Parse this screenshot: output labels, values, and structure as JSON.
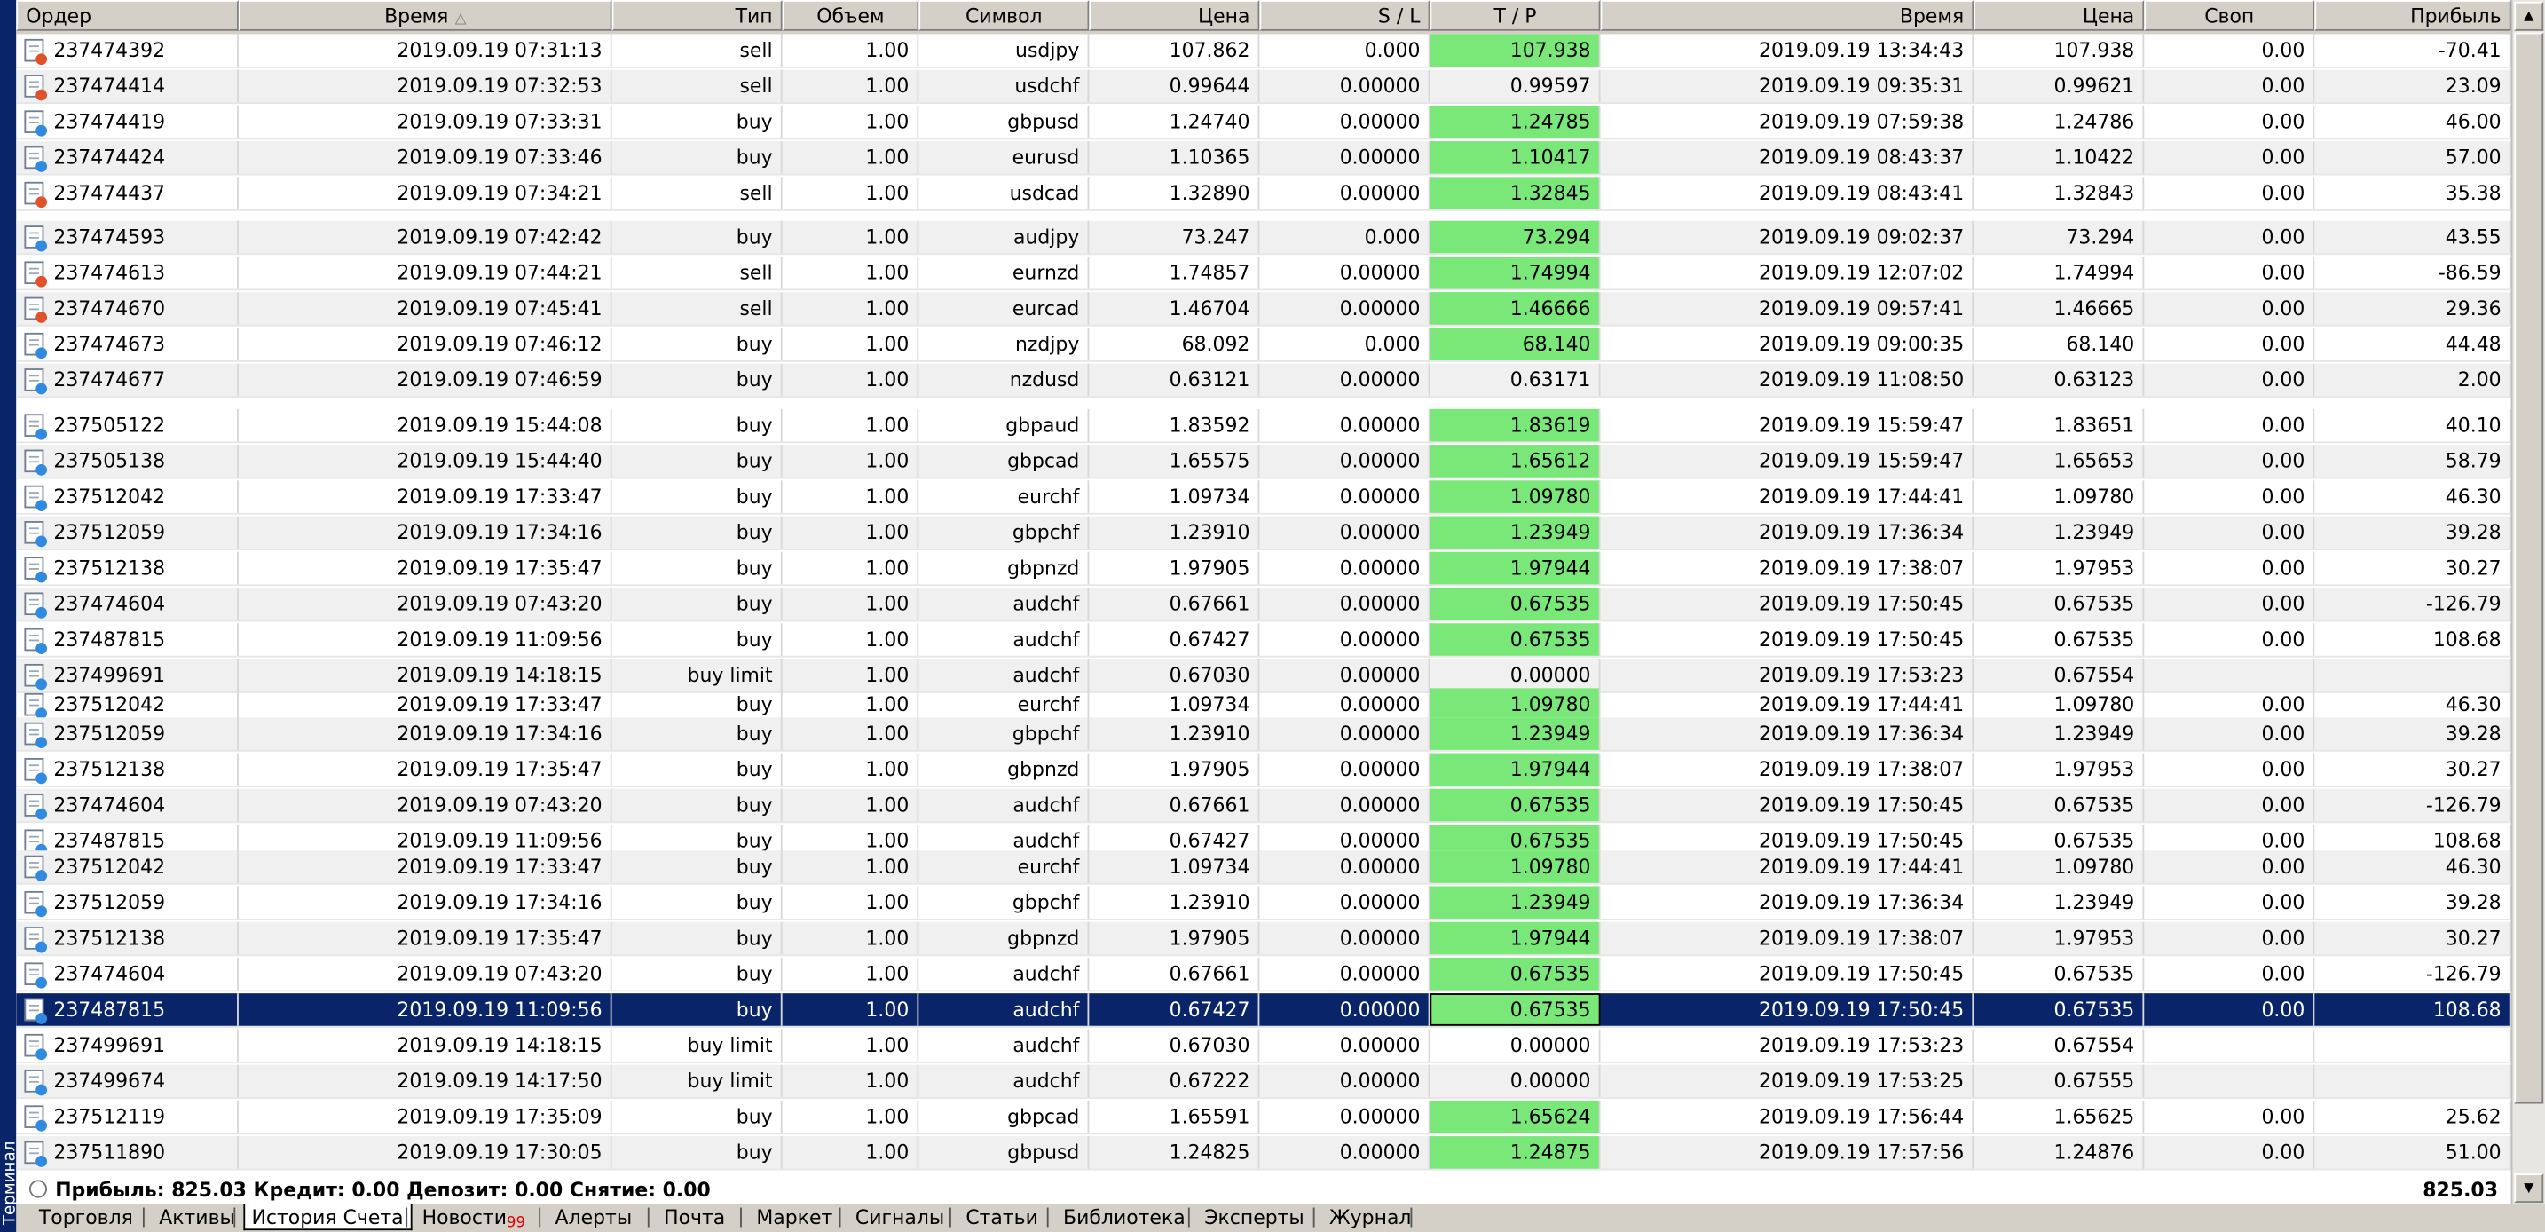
{
  "side_label": "Терминал",
  "columns": [
    {
      "key": "order",
      "label": "Ордер",
      "align": "left"
    },
    {
      "key": "open_time",
      "label": "Время",
      "align": "center",
      "sorted": true
    },
    {
      "key": "type",
      "label": "Тип",
      "align": "right"
    },
    {
      "key": "volume",
      "label": "Объем",
      "align": "center"
    },
    {
      "key": "symbol",
      "label": "Символ",
      "align": "center"
    },
    {
      "key": "price",
      "label": "Цена",
      "align": "right"
    },
    {
      "key": "sl",
      "label": "S / L",
      "align": "right"
    },
    {
      "key": "tp",
      "label": "T / P",
      "align": "center"
    },
    {
      "key": "close_time",
      "label": "Время",
      "align": "right"
    },
    {
      "key": "close_price",
      "label": "Цена",
      "align": "right"
    },
    {
      "key": "swap",
      "label": "Своп",
      "align": "center"
    },
    {
      "key": "profit",
      "label": "Прибыль",
      "align": "right"
    }
  ],
  "rows": [
    {
      "order": "237474392",
      "open_time": "2019.09.19 07:31:13",
      "type": "sell",
      "volume": "1.00",
      "symbol": "usdjpy",
      "price": "107.862",
      "sl": "0.000",
      "tp": "107.938",
      "tp_hit": true,
      "close_time": "2019.09.19 13:34:43",
      "close_price": "107.938",
      "swap": "0.00",
      "profit": "-70.41",
      "side": "sell"
    },
    {
      "order": "237474414",
      "open_time": "2019.09.19 07:32:53",
      "type": "sell",
      "volume": "1.00",
      "symbol": "usdchf",
      "price": "0.99644",
      "sl": "0.00000",
      "tp": "0.99597",
      "tp_hit": false,
      "close_time": "2019.09.19 09:35:31",
      "close_price": "0.99621",
      "swap": "0.00",
      "profit": "23.09",
      "side": "sell"
    },
    {
      "order": "237474419",
      "open_time": "2019.09.19 07:33:31",
      "type": "buy",
      "volume": "1.00",
      "symbol": "gbpusd",
      "price": "1.24740",
      "sl": "0.00000",
      "tp": "1.24785",
      "tp_hit": true,
      "close_time": "2019.09.19 07:59:38",
      "close_price": "1.24786",
      "swap": "0.00",
      "profit": "46.00",
      "side": "buy"
    },
    {
      "order": "237474424",
      "open_time": "2019.09.19 07:33:46",
      "type": "buy",
      "volume": "1.00",
      "symbol": "eurusd",
      "price": "1.10365",
      "sl": "0.00000",
      "tp": "1.10417",
      "tp_hit": true,
      "close_time": "2019.09.19 08:43:37",
      "close_price": "1.10422",
      "swap": "0.00",
      "profit": "57.00",
      "side": "buy"
    },
    {
      "order": "237474437",
      "open_time": "2019.09.19 07:34:21",
      "type": "sell",
      "volume": "1.00",
      "symbol": "usdcad",
      "price": "1.32890",
      "sl": "0.00000",
      "tp": "1.32845",
      "tp_hit": true,
      "close_time": "2019.09.19 08:43:41",
      "close_price": "1.32843",
      "swap": "0.00",
      "profit": "35.38",
      "side": "sell"
    },
    {
      "order": "237474593",
      "open_time": "2019.09.19 07:42:42",
      "type": "buy",
      "volume": "1.00",
      "symbol": "audjpy",
      "price": "73.247",
      "sl": "0.000",
      "tp": "73.294",
      "tp_hit": true,
      "close_time": "2019.09.19 09:02:37",
      "close_price": "73.294",
      "swap": "0.00",
      "profit": "43.55",
      "side": "buy"
    },
    {
      "order": "237474613",
      "open_time": "2019.09.19 07:44:21",
      "type": "sell",
      "volume": "1.00",
      "symbol": "eurnzd",
      "price": "1.74857",
      "sl": "0.00000",
      "tp": "1.74994",
      "tp_hit": true,
      "close_time": "2019.09.19 12:07:02",
      "close_price": "1.74994",
      "swap": "0.00",
      "profit": "-86.59",
      "side": "sell"
    },
    {
      "order": "237474670",
      "open_time": "2019.09.19 07:45:41",
      "type": "sell",
      "volume": "1.00",
      "symbol": "eurcad",
      "price": "1.46704",
      "sl": "0.00000",
      "tp": "1.46666",
      "tp_hit": true,
      "close_time": "2019.09.19 09:57:41",
      "close_price": "1.46665",
      "swap": "0.00",
      "profit": "29.36",
      "side": "sell"
    },
    {
      "order": "237474673",
      "open_time": "2019.09.19 07:46:12",
      "type": "buy",
      "volume": "1.00",
      "symbol": "nzdjpy",
      "price": "68.092",
      "sl": "0.000",
      "tp": "68.140",
      "tp_hit": true,
      "close_time": "2019.09.19 09:00:35",
      "close_price": "68.140",
      "swap": "0.00",
      "profit": "44.48",
      "side": "buy"
    },
    {
      "order": "237474677",
      "open_time": "2019.09.19 07:46:59",
      "type": "buy",
      "volume": "1.00",
      "symbol": "nzdusd",
      "price": "0.63121",
      "sl": "0.00000",
      "tp": "0.63171",
      "tp_hit": false,
      "close_time": "2019.09.19 11:08:50",
      "close_price": "0.63123",
      "swap": "0.00",
      "profit": "2.00",
      "side": "buy"
    },
    {
      "order": "237505122",
      "open_time": "2019.09.19 15:44:08",
      "type": "buy",
      "volume": "1.00",
      "symbol": "gbpaud",
      "price": "1.83592",
      "sl": "0.00000",
      "tp": "1.83619",
      "tp_hit": true,
      "close_time": "2019.09.19 15:59:47",
      "close_price": "1.83651",
      "swap": "0.00",
      "profit": "40.10",
      "side": "buy"
    },
    {
      "order": "237505138",
      "open_time": "2019.09.19 15:44:40",
      "type": "buy",
      "volume": "1.00",
      "symbol": "gbpcad",
      "price": "1.65575",
      "sl": "0.00000",
      "tp": "1.65612",
      "tp_hit": true,
      "close_time": "2019.09.19 15:59:47",
      "close_price": "1.65653",
      "swap": "0.00",
      "profit": "58.79",
      "side": "buy"
    },
    {
      "order": "237512042",
      "open_time": "2019.09.19 17:33:47",
      "type": "buy",
      "volume": "1.00",
      "symbol": "eurchf",
      "price": "1.09734",
      "sl": "0.00000",
      "tp": "1.09780",
      "tp_hit": true,
      "close_time": "2019.09.19 17:44:41",
      "close_price": "1.09780",
      "swap": "0.00",
      "profit": "46.30",
      "side": "buy"
    },
    {
      "order": "237512059",
      "open_time": "2019.09.19 17:34:16",
      "type": "buy",
      "volume": "1.00",
      "symbol": "gbpchf",
      "price": "1.23910",
      "sl": "0.00000",
      "tp": "1.23949",
      "tp_hit": true,
      "close_time": "2019.09.19 17:36:34",
      "close_price": "1.23949",
      "swap": "0.00",
      "profit": "39.28",
      "side": "buy"
    },
    {
      "order": "237512138",
      "open_time": "2019.09.19 17:35:47",
      "type": "buy",
      "volume": "1.00",
      "symbol": "gbpnzd",
      "price": "1.97905",
      "sl": "0.00000",
      "tp": "1.97944",
      "tp_hit": true,
      "close_time": "2019.09.19 17:38:07",
      "close_price": "1.97953",
      "swap": "0.00",
      "profit": "30.27",
      "side": "buy"
    },
    {
      "order": "237474604",
      "open_time": "2019.09.19 07:43:20",
      "type": "buy",
      "volume": "1.00",
      "symbol": "audchf",
      "price": "0.67661",
      "sl": "0.00000",
      "tp": "0.67535",
      "tp_hit": true,
      "close_time": "2019.09.19 17:50:45",
      "close_price": "0.67535",
      "swap": "0.00",
      "profit": "-126.79",
      "side": "buy"
    },
    {
      "order": "237487815",
      "open_time": "2019.09.19 11:09:56",
      "type": "buy",
      "volume": "1.00",
      "symbol": "audchf",
      "price": "0.67427",
      "sl": "0.00000",
      "tp": "0.67535",
      "tp_hit": true,
      "close_time": "2019.09.19 17:50:45",
      "close_price": "0.67535",
      "swap": "0.00",
      "profit": "108.68",
      "side": "buy"
    },
    {
      "order": "237499691",
      "open_time": "2019.09.19 14:18:15",
      "type": "buy limit",
      "volume": "1.00",
      "symbol": "audchf",
      "price": "0.67030",
      "sl": "0.00000",
      "tp": "0.00000",
      "tp_hit": false,
      "close_time": "2019.09.19 17:53:23",
      "close_price": "0.67554",
      "swap": "",
      "profit": "",
      "side": "buy"
    },
    {
      "order": "237512042",
      "open_time": "2019.09.19 17:33:47",
      "type": "buy",
      "volume": "1.00",
      "symbol": "eurchf",
      "price": "1.09734",
      "sl": "0.00000",
      "tp": "1.09780",
      "tp_hit": true,
      "close_time": "2019.09.19 17:44:41",
      "close_price": "1.09780",
      "swap": "0.00",
      "profit": "46.30",
      "side": "buy"
    },
    {
      "order": "237512059",
      "open_time": "2019.09.19 17:34:16",
      "type": "buy",
      "volume": "1.00",
      "symbol": "gbpchf",
      "price": "1.23910",
      "sl": "0.00000",
      "tp": "1.23949",
      "tp_hit": true,
      "close_time": "2019.09.19 17:36:34",
      "close_price": "1.23949",
      "swap": "0.00",
      "profit": "39.28",
      "side": "buy"
    },
    {
      "order": "237512138",
      "open_time": "2019.09.19 17:35:47",
      "type": "buy",
      "volume": "1.00",
      "symbol": "gbpnzd",
      "price": "1.97905",
      "sl": "0.00000",
      "tp": "1.97944",
      "tp_hit": true,
      "close_time": "2019.09.19 17:38:07",
      "close_price": "1.97953",
      "swap": "0.00",
      "profit": "30.27",
      "side": "buy"
    },
    {
      "order": "237474604",
      "open_time": "2019.09.19 07:43:20",
      "type": "buy",
      "volume": "1.00",
      "symbol": "audchf",
      "price": "0.67661",
      "sl": "0.00000",
      "tp": "0.67535",
      "tp_hit": true,
      "close_time": "2019.09.19 17:50:45",
      "close_price": "0.67535",
      "swap": "0.00",
      "profit": "-126.79",
      "side": "buy"
    },
    {
      "order": "237487815",
      "open_time": "2019.09.19 11:09:56",
      "type": "buy",
      "volume": "1.00",
      "symbol": "audchf",
      "price": "0.67427",
      "sl": "0.00000",
      "tp": "0.67535",
      "tp_hit": true,
      "close_time": "2019.09.19 17:50:45",
      "close_price": "0.67535",
      "swap": "0.00",
      "profit": "108.68",
      "side": "buy"
    },
    {
      "order": "237512042",
      "open_time": "2019.09.19 17:33:47",
      "type": "buy",
      "volume": "1.00",
      "symbol": "eurchf",
      "price": "1.09734",
      "sl": "0.00000",
      "tp": "1.09780",
      "tp_hit": true,
      "close_time": "2019.09.19 17:44:41",
      "close_price": "1.09780",
      "swap": "0.00",
      "profit": "46.30",
      "side": "buy"
    },
    {
      "order": "237512059",
      "open_time": "2019.09.19 17:34:16",
      "type": "buy",
      "volume": "1.00",
      "symbol": "gbpchf",
      "price": "1.23910",
      "sl": "0.00000",
      "tp": "1.23949",
      "tp_hit": true,
      "close_time": "2019.09.19 17:36:34",
      "close_price": "1.23949",
      "swap": "0.00",
      "profit": "39.28",
      "side": "buy"
    },
    {
      "order": "237512138",
      "open_time": "2019.09.19 17:35:47",
      "type": "buy",
      "volume": "1.00",
      "symbol": "gbpnzd",
      "price": "1.97905",
      "sl": "0.00000",
      "tp": "1.97944",
      "tp_hit": true,
      "close_time": "2019.09.19 17:38:07",
      "close_price": "1.97953",
      "swap": "0.00",
      "profit": "30.27",
      "side": "buy"
    },
    {
      "order": "237474604",
      "open_time": "2019.09.19 07:43:20",
      "type": "buy",
      "volume": "1.00",
      "symbol": "audchf",
      "price": "0.67661",
      "sl": "0.00000",
      "tp": "0.67535",
      "tp_hit": true,
      "close_time": "2019.09.19 17:50:45",
      "close_price": "0.67535",
      "swap": "0.00",
      "profit": "-126.79",
      "side": "buy"
    },
    {
      "order": "237487815",
      "open_time": "2019.09.19 11:09:56",
      "type": "buy",
      "volume": "1.00",
      "symbol": "audchf",
      "price": "0.67427",
      "sl": "0.00000",
      "tp": "0.67535",
      "tp_hit": true,
      "close_time": "2019.09.19 17:50:45",
      "close_price": "0.67535",
      "swap": "0.00",
      "profit": "108.68",
      "side": "buy",
      "selected": true
    },
    {
      "order": "237499691",
      "open_time": "2019.09.19 14:18:15",
      "type": "buy limit",
      "volume": "1.00",
      "symbol": "audchf",
      "price": "0.67030",
      "sl": "0.00000",
      "tp": "0.00000",
      "tp_hit": false,
      "close_time": "2019.09.19 17:53:23",
      "close_price": "0.67554",
      "swap": "",
      "profit": "",
      "side": "buy"
    },
    {
      "order": "237499674",
      "open_time": "2019.09.19 14:17:50",
      "type": "buy limit",
      "volume": "1.00",
      "symbol": "audchf",
      "price": "0.67222",
      "sl": "0.00000",
      "tp": "0.00000",
      "tp_hit": false,
      "close_time": "2019.09.19 17:53:25",
      "close_price": "0.67555",
      "swap": "",
      "profit": "",
      "side": "buy"
    },
    {
      "order": "237512119",
      "open_time": "2019.09.19 17:35:09",
      "type": "buy",
      "volume": "1.00",
      "symbol": "gbpcad",
      "price": "1.65591",
      "sl": "0.00000",
      "tp": "1.65624",
      "tp_hit": true,
      "close_time": "2019.09.19 17:56:44",
      "close_price": "1.65625",
      "swap": "0.00",
      "profit": "25.62",
      "side": "buy"
    },
    {
      "order": "237511890",
      "open_time": "2019.09.19 17:30:05",
      "type": "buy",
      "volume": "1.00",
      "symbol": "gbpusd",
      "price": "1.24825",
      "sl": "0.00000",
      "tp": "1.24875",
      "tp_hit": true,
      "close_time": "2019.09.19 17:57:56",
      "close_price": "1.24876",
      "swap": "0.00",
      "profit": "51.00",
      "side": "buy"
    }
  ],
  "summary": {
    "text": "Прибыль: 825.03  Кредит: 0.00  Депозит: 0.00  Снятие: 0.00",
    "total": "825.03"
  },
  "tabs": [
    {
      "label": "Торговля"
    },
    {
      "label": "Активы"
    },
    {
      "label": "История Счета",
      "active": true
    },
    {
      "label": "Новости",
      "badge": "99"
    },
    {
      "label": "Алерты"
    },
    {
      "label": "Почта"
    },
    {
      "label": "Маркет"
    },
    {
      "label": "Сигналы"
    },
    {
      "label": "Статьи"
    },
    {
      "label": "Библиотека"
    },
    {
      "label": "Эксперты"
    },
    {
      "label": "Журнал"
    }
  ],
  "colors": {
    "tp_highlight": "#79e879",
    "selection": "#0a246a",
    "sell_dot": "#e0532a",
    "buy_dot": "#2f8ae0"
  },
  "icons": {
    "order_row": "order-document-icon",
    "scroll_up": "arrow-up-icon",
    "scroll_down": "arrow-down-icon",
    "summary": "circle-icon"
  }
}
